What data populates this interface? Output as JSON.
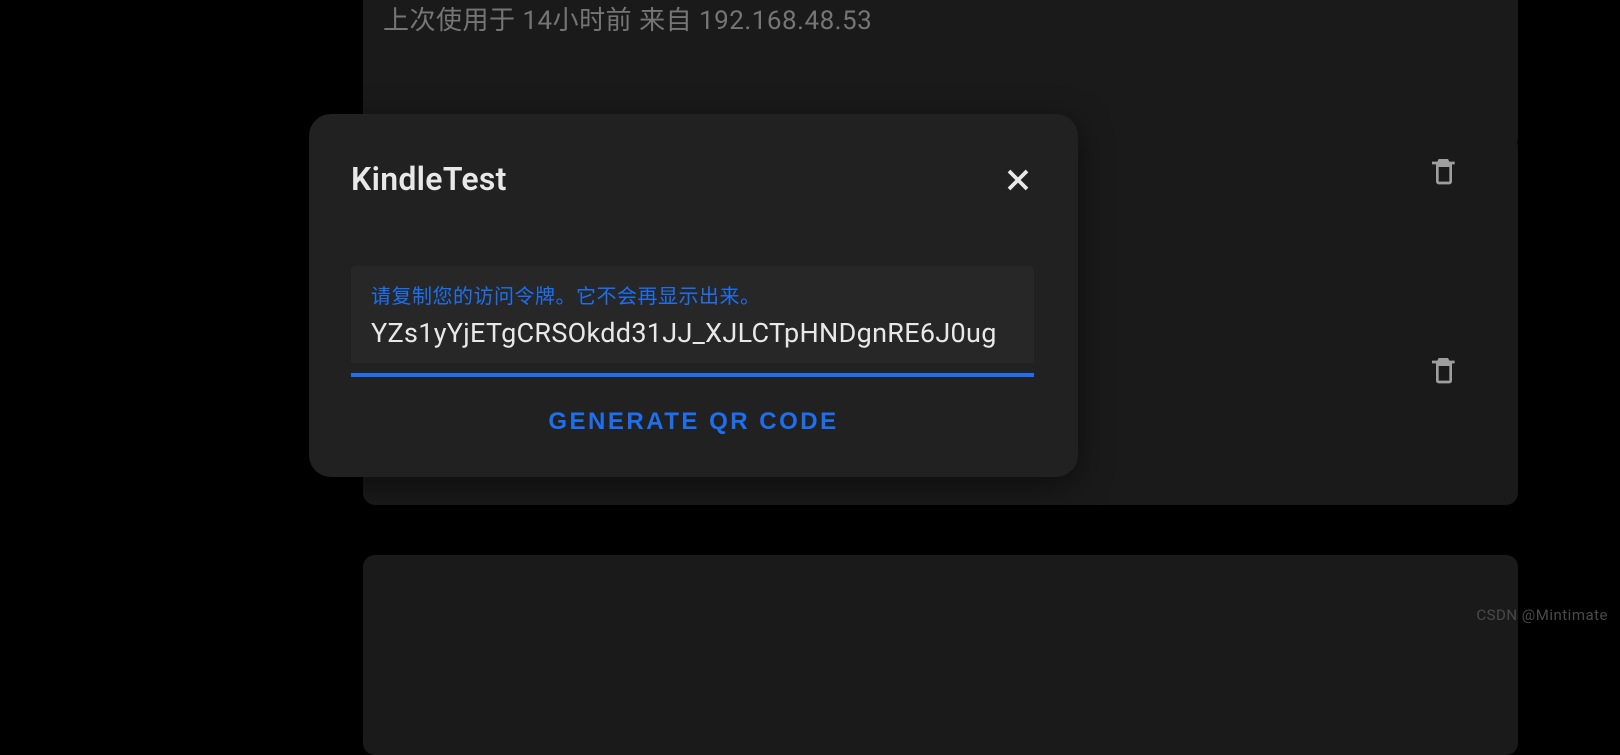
{
  "background": {
    "last_used_text": "上次使用于 14小时前 来自 192.168.48.53"
  },
  "dialog": {
    "title": "KindleTest",
    "token_hint": "请复制您的访问令牌。它不会再显示出来。",
    "token_value": "YZs1yYjETgCRSOkdd31JJ_XJLCTpHNDgnRE6J0ug",
    "generate_qr_label": "GENERATE QR CODE"
  },
  "watermark": "CSDN @Mintimate"
}
